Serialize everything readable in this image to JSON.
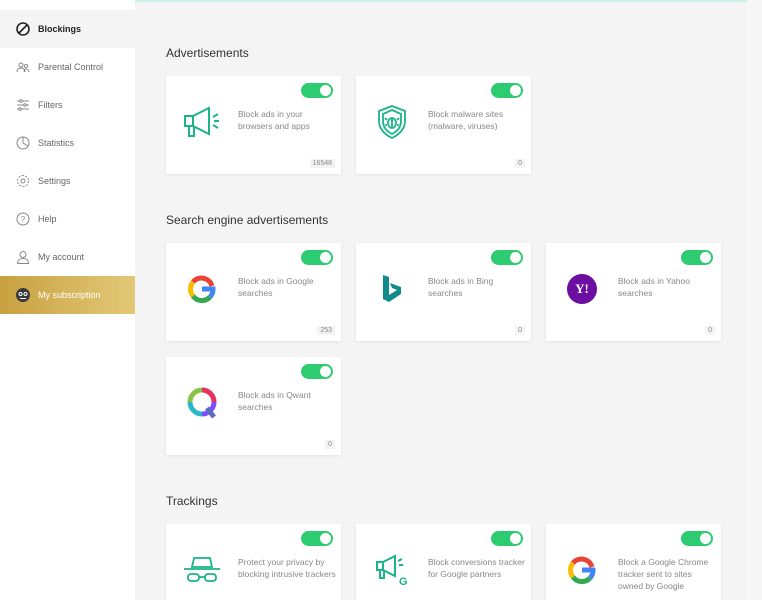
{
  "sidebar": {
    "items": [
      {
        "label": "Blockings",
        "icon": "block-icon",
        "active": true
      },
      {
        "label": "Parental Control",
        "icon": "parental-icon"
      },
      {
        "label": "Filters",
        "icon": "filters-icon"
      },
      {
        "label": "Statistics",
        "icon": "statistics-icon"
      },
      {
        "label": "Settings",
        "icon": "gear-icon"
      },
      {
        "label": "Help",
        "icon": "help-icon"
      },
      {
        "label": "My account",
        "icon": "user-icon"
      },
      {
        "label": "My subscription",
        "icon": "mascot-icon",
        "highlight": "#d4b257"
      }
    ]
  },
  "sections": {
    "ads": {
      "title": "Advertisements"
    },
    "search": {
      "title": "Search engine advertisements"
    },
    "track": {
      "title": "Trackings"
    }
  },
  "cards": {
    "ads_block": {
      "desc": "Block ads in your browsers and apps",
      "count": "16548",
      "enabled": true,
      "icon": "megaphone-icon"
    },
    "malware": {
      "desc": "Block malware sites (malware, viruses)",
      "count": "0",
      "enabled": true,
      "icon": "shield-bug-icon"
    },
    "google": {
      "desc": "Block ads in Google searches",
      "count": "253",
      "enabled": true,
      "icon": "google-icon"
    },
    "bing": {
      "desc": "Block ads in Bing searches",
      "count": "0",
      "enabled": true,
      "icon": "bing-icon"
    },
    "yahoo": {
      "desc": "Block ads in Yahoo searches",
      "count": "0",
      "enabled": true,
      "icon": "yahoo-icon",
      "yahoo_text": "Y!"
    },
    "qwant": {
      "desc": "Block ads in Qwant searches",
      "count": "0",
      "enabled": true,
      "icon": "qwant-icon"
    },
    "privacy": {
      "desc": "Protect your privacy by blocking intrusive trackers",
      "enabled": true,
      "icon": "spy-icon"
    },
    "conversions": {
      "desc": "Block conversions tracker for Google partners",
      "enabled": true,
      "icon": "megaphone-google-icon"
    },
    "chrome": {
      "desc": "Block a Google Chrome tracker sent to sites owned by Google",
      "enabled": true,
      "icon": "google-icon"
    }
  },
  "colors": {
    "accent": "#2ecc71",
    "icon_green": "#1bb38a",
    "bing": "#138a8a",
    "yahoo": "#6b0ea1"
  }
}
